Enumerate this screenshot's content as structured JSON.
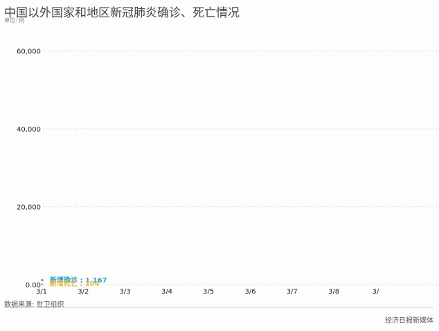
{
  "header": {
    "title": "中国以外国家和地区新冠肺炎确诊、死亡情况",
    "unit": "单位: 例"
  },
  "footer": {
    "source": "数据来源: 世卫组织",
    "brand": "经济日报新媒体"
  },
  "chart_data": {
    "type": "line",
    "title": "中国以外国家和地区新冠肺炎确诊、死亡情况",
    "xlabel": "",
    "ylabel": "",
    "categories": [
      "3/1",
      "3/2",
      "3/3",
      "3/4",
      "3/5",
      "3/6",
      "3/7",
      "3/8",
      "3/"
    ],
    "ylim": [
      0,
      66000
    ],
    "yticks": [
      0,
      20000,
      40000,
      60000
    ],
    "ytick_labels": [
      "0.00",
      "20,000",
      "40,000",
      "60,000"
    ],
    "grid": true,
    "series": [
      {
        "name": "新增确诊",
        "values": [
          1167
        ],
        "color": "#2aa4c8",
        "label": "新增确诊 : 1,167"
      },
      {
        "name": "新增死亡",
        "values": [
          104
        ],
        "color": "#e9b94a",
        "label": "新增死亡 : 104"
      }
    ]
  }
}
